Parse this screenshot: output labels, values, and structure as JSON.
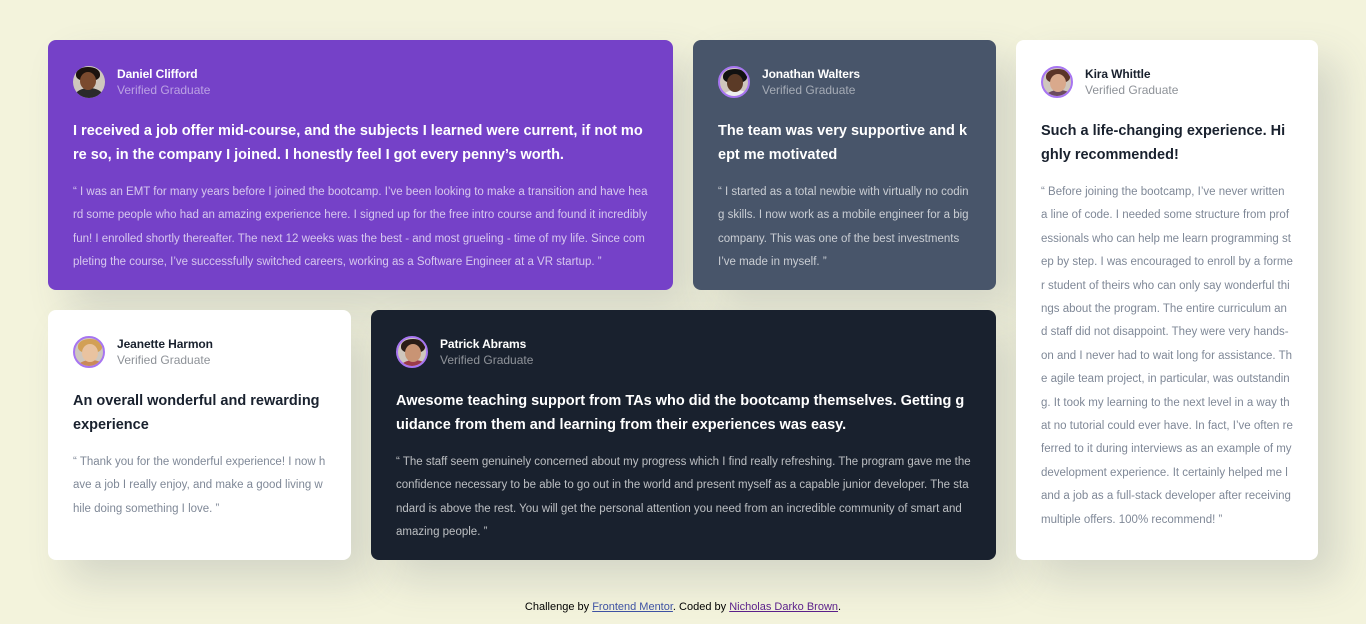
{
  "testimonials": [
    {
      "name": "Daniel Clifford",
      "role": "Verified Graduate",
      "headline": "I received a job offer mid-course, and the subjects I learned were current, if not more so, in the company I joined. I honestly feel I got every penny’s worth.",
      "quote": "“ I was an EMT for many years before I joined the bootcamp. I’ve been looking to make a transition and have heard some people who had an amazing experience here. I signed up for the free intro course and found it incredibly fun! I enrolled shortly thereafter. The next 12 weeks was the best - and most grueling - time of my life. Since completing the course, I’ve successfully switched careers, working as a Software Engineer at a VR startup. ”",
      "avatar": {
        "skin": "#7a4a2e",
        "hair": "#1c130e",
        "shirt": "#2a2a2a"
      }
    },
    {
      "name": "Jonathan Walters",
      "role": "Verified Graduate",
      "headline": "The team was very supportive and kept me motivated",
      "quote": "“ I started as a total newbie with virtually no coding skills. I now work as a mobile engineer for a big company. This was one of the best investments I’ve made in myself. ”",
      "avatar": {
        "skin": "#5b3a26",
        "hair": "#111111",
        "shirt": "#eeeeee"
      }
    },
    {
      "name": "Jeanette Harmon",
      "role": "Verified Graduate",
      "headline": "An overall wonderful and rewarding experience",
      "quote": "“ Thank you for the wonderful experience! I now have a job I really enjoy, and make a good living while doing something I love. ”",
      "avatar": {
        "skin": "#e9c3a0",
        "hair": "#d2a055",
        "shirt": "#c98a5a"
      }
    },
    {
      "name": "Patrick Abrams",
      "role": "Verified Graduate",
      "headline": "Awesome teaching support from TAs who did the bootcamp themselves. Getting guidance from them and learning from their experiences was easy.",
      "quote": "“ The staff seem genuinely concerned about my progress which I find really refreshing. The program gave me the confidence necessary to be able to go out in the world and present myself as a capable junior developer. The standard is above the rest. You will get the personal attention you need from an incredible community of smart and amazing people. ”",
      "avatar": {
        "skin": "#c99474",
        "hair": "#2a1c16",
        "shirt": "#9b3b4a"
      }
    },
    {
      "name": "Kira Whittle",
      "role": "Verified Graduate",
      "headline": "Such a life-changing experience. Highly recommended!",
      "quote": "“ Before joining the bootcamp, I’ve never written a line of code. I needed some structure from professionals who can help me learn programming step by step. I was encouraged to enroll by a former student of theirs who can only say wonderful things about the program. The entire curriculum and staff did not disappoint. They were very hands-on and I never had to wait long for assistance. The agile team project, in particular, was outstanding. It took my learning to the next level in a way that no tutorial could ever have. In fact, I’ve often referred to it during interviews as an example of my development experience. It certainly helped me land a job as a full-stack developer after receiving multiple offers. 100% recommend! ”",
      "avatar": {
        "skin": "#d9a98c",
        "hair": "#5a3428",
        "shirt": "#6b4a5e"
      }
    }
  ],
  "attribution": {
    "prefix": "Challenge by ",
    "link1": "Frontend Mentor",
    "middle": ". Coded by ",
    "link2": "Nicholas Darko Brown",
    "suffix": "."
  },
  "colors": {
    "background": "#f3f3dc",
    "purple": "#7541c8",
    "grayish-blue": "#48556a",
    "dark-blue": "#19212e",
    "white": "#ffffff",
    "avatar-ring": "#a775f1"
  }
}
